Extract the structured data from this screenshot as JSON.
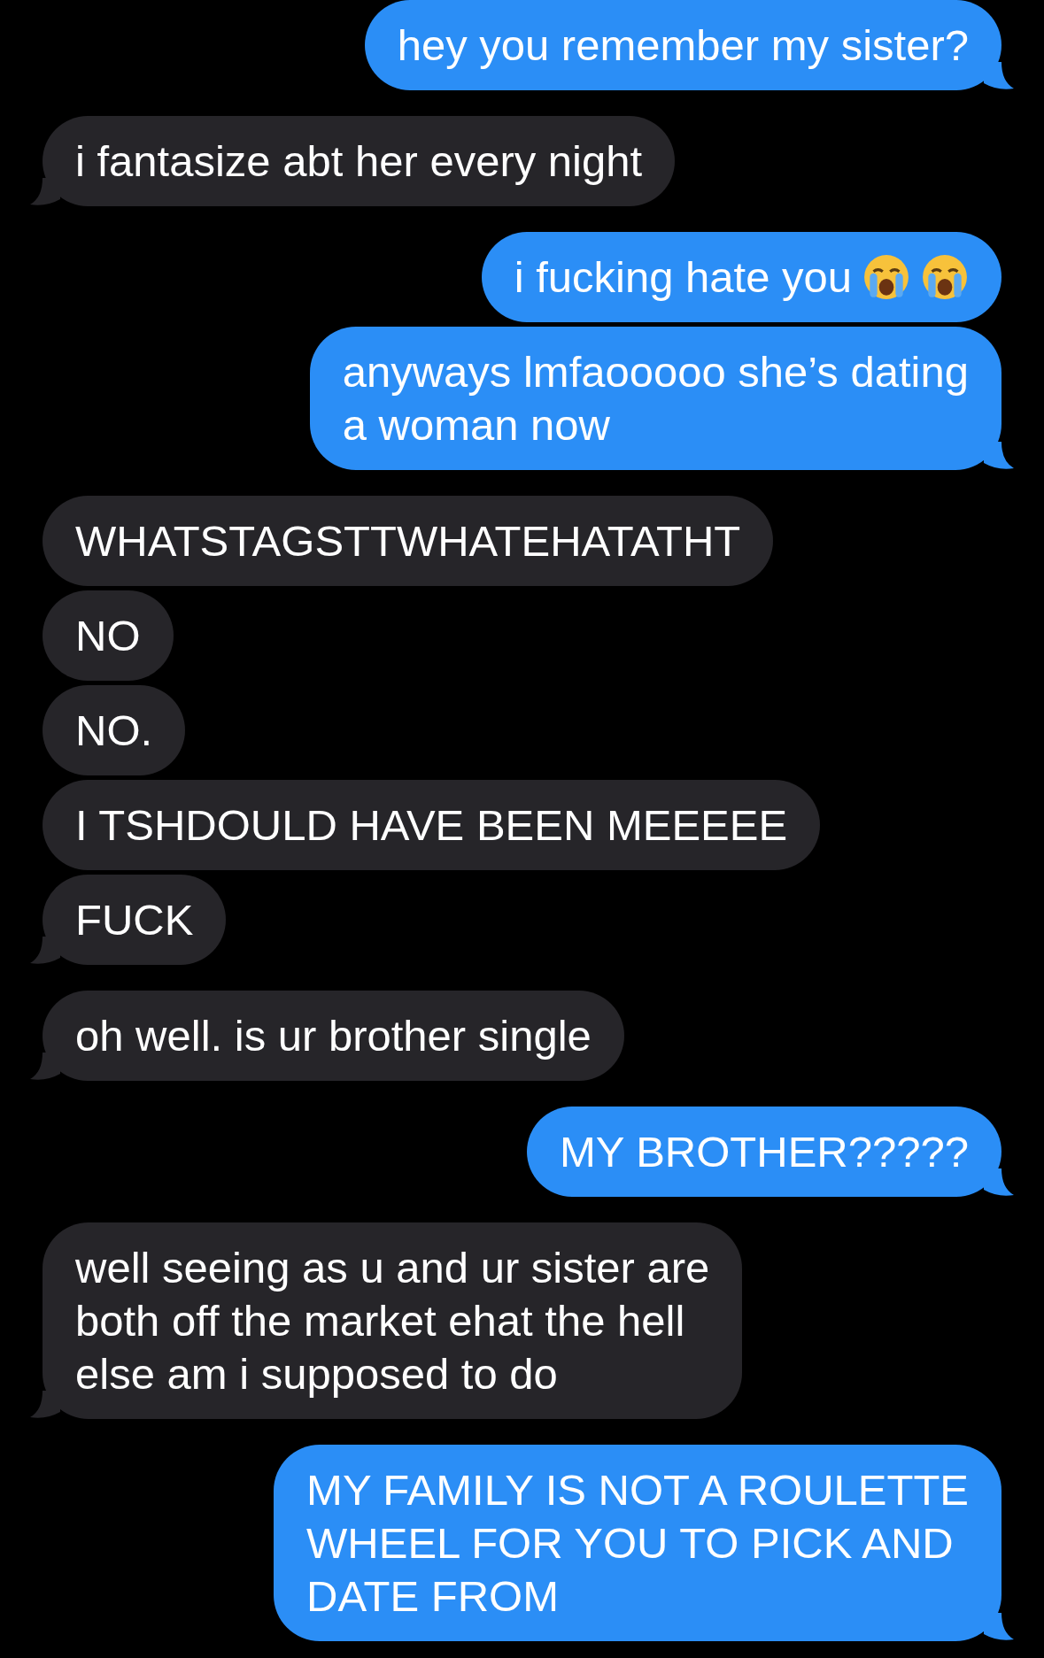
{
  "messages": [
    {
      "kind": "sent",
      "lines": [
        "hey you remember my sister?"
      ],
      "tail": true
    },
    {
      "kind": "received",
      "lines": [
        "i fantasize abt her every night"
      ],
      "tail": true
    },
    {
      "kind": "sent",
      "lines": [
        "i fucking hate you"
      ],
      "tail": false,
      "trailing_icons": [
        {
          "kind": "crying-face"
        },
        {
          "kind": "crying-face"
        }
      ]
    },
    {
      "kind": "sent",
      "lines": [
        "anyways lmfaooooo she’s dating",
        "a woman now"
      ],
      "tail": true
    },
    {
      "kind": "received",
      "lines": [
        "WHATSTAGSTTWHATEHATATHT"
      ],
      "tail": false
    },
    {
      "kind": "received",
      "lines": [
        "NO"
      ],
      "tail": false
    },
    {
      "kind": "received",
      "lines": [
        "NO."
      ],
      "tail": false
    },
    {
      "kind": "received",
      "lines": [
        "I TSHDOULD HAVE BEEN MEEEEE"
      ],
      "tail": false
    },
    {
      "kind": "received",
      "lines": [
        "FUCK"
      ],
      "tail": true
    },
    {
      "kind": "received",
      "lines": [
        "oh well. is ur brother single"
      ],
      "tail": true
    },
    {
      "kind": "sent",
      "lines": [
        "MY BROTHER?????"
      ],
      "tail": true
    },
    {
      "kind": "received",
      "lines": [
        "well seeing as u and ur sister are",
        "both off the market ehat the hell",
        "else am i supposed to do"
      ],
      "tail": true
    },
    {
      "kind": "sent",
      "lines": [
        "MY FAMILY IS NOT A ROULETTE",
        "WHEEL FOR YOU TO PICK AND",
        "DATE FROM"
      ],
      "tail": true
    }
  ]
}
